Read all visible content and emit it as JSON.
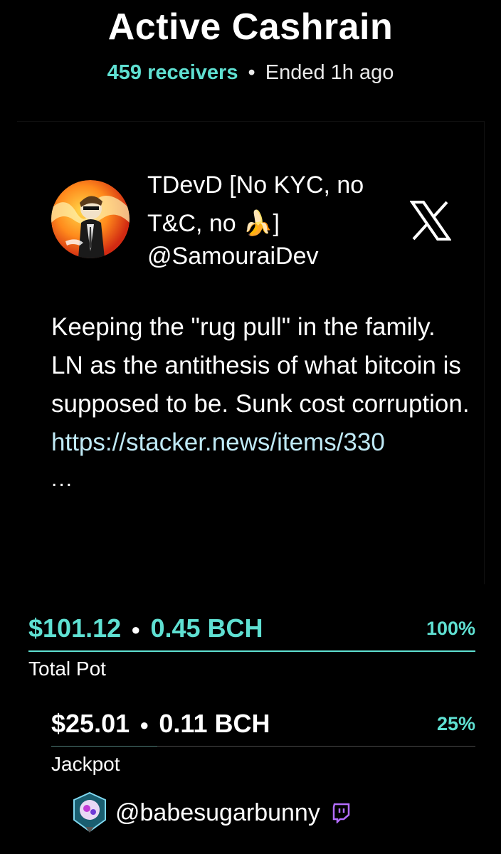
{
  "header": {
    "title": "Active Cashrain",
    "receivers": "459 receivers",
    "separator": "•",
    "status": "Ended 1h ago"
  },
  "tweet": {
    "author_name": "TDevD [No KYC, no T&C, no 🍌]",
    "author_handle": "@SamouraiDev",
    "platform_icon": "x-logo-icon",
    "text": "Keeping the \"rug pull\" in the family. LN as the antithesis of what bitcoin is supposed to be. Sunk cost corruption.",
    "link": "https://stacker.news/items/330",
    "ellipsis": "..."
  },
  "total_pot": {
    "usd": "$101.12",
    "bch": "0.45 BCH",
    "percent": "100%",
    "label": "Total Pot",
    "fill_fraction": 1.0,
    "bar_color": "#5fe0d2"
  },
  "jackpot": {
    "usd": "$25.01",
    "bch": "0.11 BCH",
    "percent": "25%",
    "label": "Jackpot",
    "fill_fraction": 0.25,
    "bar_color": "#5fe0d2"
  },
  "winner": {
    "handle": "@babesugarbunny",
    "platform_icon": "twitch-icon"
  },
  "colors": {
    "accent": "#5fe0d2",
    "background": "#000000",
    "text": "#ffffff"
  }
}
